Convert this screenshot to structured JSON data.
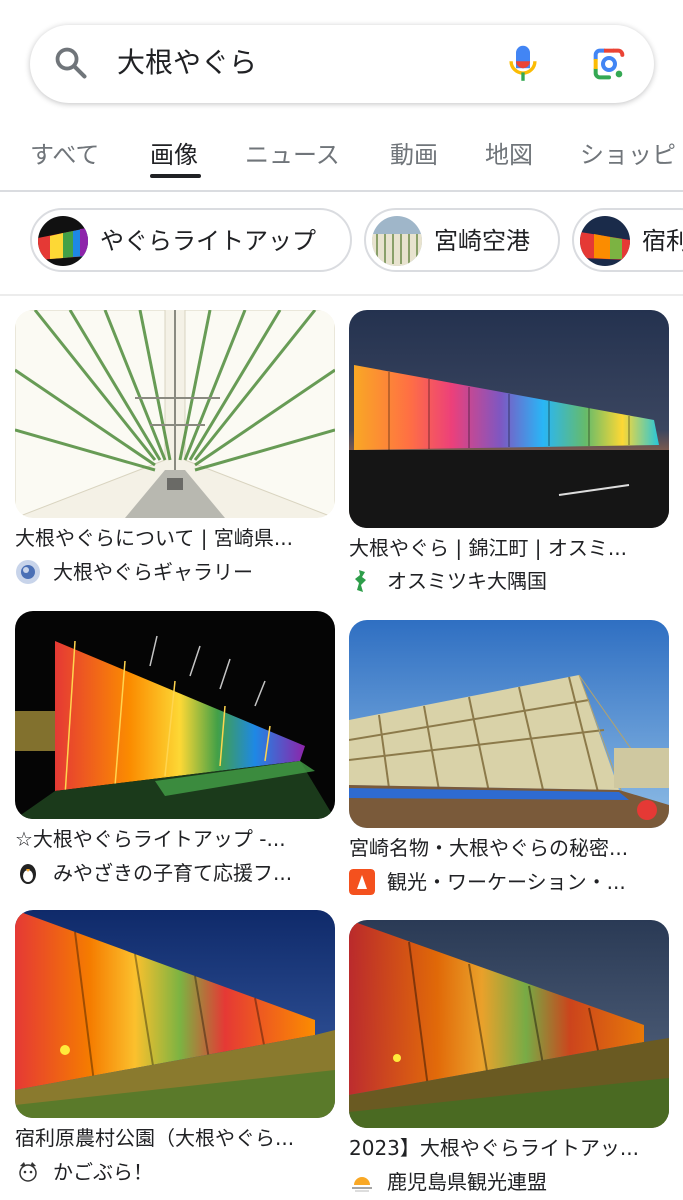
{
  "search": {
    "query": "大根やぐら"
  },
  "tabs": [
    {
      "label": "すべて",
      "active": false
    },
    {
      "label": "画像",
      "active": true
    },
    {
      "label": "ニュース",
      "active": false
    },
    {
      "label": "動画",
      "active": false
    },
    {
      "label": "地図",
      "active": false
    },
    {
      "label": "ショッピ",
      "active": false
    }
  ],
  "chips": [
    {
      "label": "やぐらライトアップ",
      "thumb": "rainbow-lights"
    },
    {
      "label": "宮崎空港",
      "thumb": "daikon-rack"
    },
    {
      "label": "宿利",
      "thumb": "rainbow-lights"
    }
  ],
  "results": [
    {
      "title": "大根やぐらについて | 宮崎県...",
      "source": "大根やぐらギャラリー",
      "source_icon": "globe-icon",
      "image": "daikon-tunnel"
    },
    {
      "title": "大根やぐら | 錦江町 | オスミ...",
      "source": "オスミツキ大隅国",
      "source_icon": "green-map-icon",
      "image": "rainbow-dusk"
    },
    {
      "title": "☆大根やぐらライトアップ -...",
      "source": "みやざきの子育て応援フ...",
      "source_icon": "penguin-icon",
      "image": "rainbow-night"
    },
    {
      "title": "宮崎名物・大根やぐらの秘密...",
      "source": "観光・ワーケーション・...",
      "source_icon": "orange-square-icon",
      "image": "daytime-rack"
    },
    {
      "title": "宿利原農村公園（大根やぐら...",
      "source": "かごぶら！",
      "source_icon": "cat-icon",
      "image": "colorful-rack"
    },
    {
      "title": "2023】大根やぐらライトアッ...",
      "source": "鹿児島県観光連盟",
      "source_icon": "sun-logo-icon",
      "image": "colorful-rack-dark"
    }
  ],
  "colors": {
    "text_primary": "#202124",
    "text_secondary": "#70757a",
    "divider": "#dadce0",
    "mic_blue": "#4285f4",
    "mic_red": "#ea4335",
    "lens_green": "#34a853",
    "lens_yellow": "#fbbc04"
  }
}
